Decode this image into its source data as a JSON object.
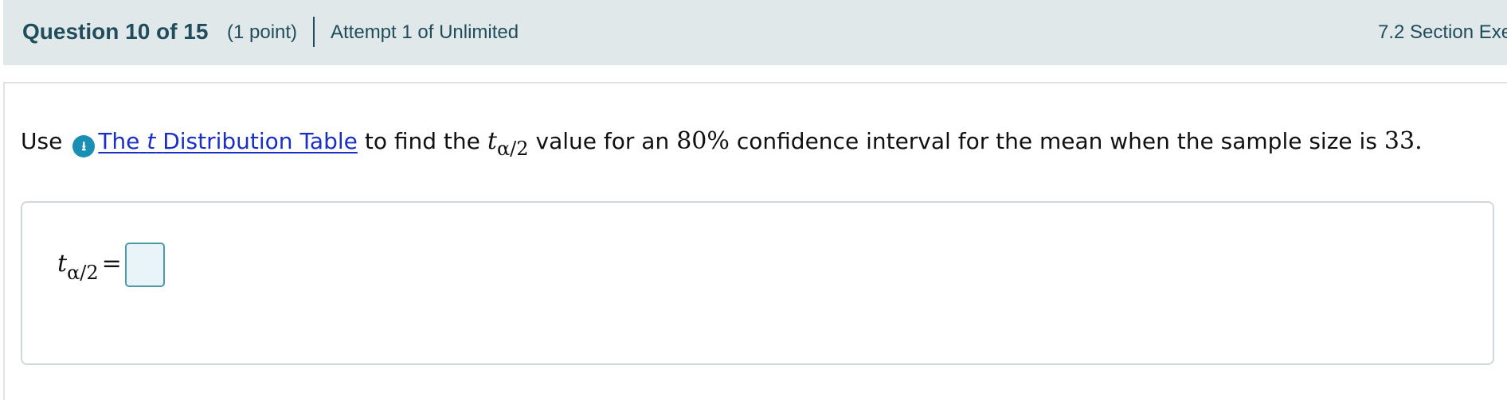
{
  "header": {
    "question_label": "Question 10 of 15",
    "points": "(1 point)",
    "attempt": "Attempt 1 of Unlimited",
    "section": "7.2 Section Exe"
  },
  "question": {
    "prefix": "Use",
    "link_part1": "The",
    "link_italic": "t",
    "link_part2": "Distribution Table",
    "text1": "to find the",
    "t_symbol": "t",
    "subscript": "α/2",
    "text2": "value for an",
    "percent": "80%",
    "text3": "confidence interval for the mean when the sample size is",
    "sample_size": "33."
  },
  "answer": {
    "label_symbol": "t",
    "label_subscript": "α/2",
    "equals": "=",
    "value": ""
  },
  "colors": {
    "header_bg": "#e1e8ea",
    "header_text": "#1f4d5c",
    "link": "#1a2fc7",
    "icon_bg": "#1a8fb4",
    "input_border": "#4a9aa8",
    "input_bg": "#e8f4f8"
  },
  "icons": {
    "download": "download-circle-icon"
  }
}
